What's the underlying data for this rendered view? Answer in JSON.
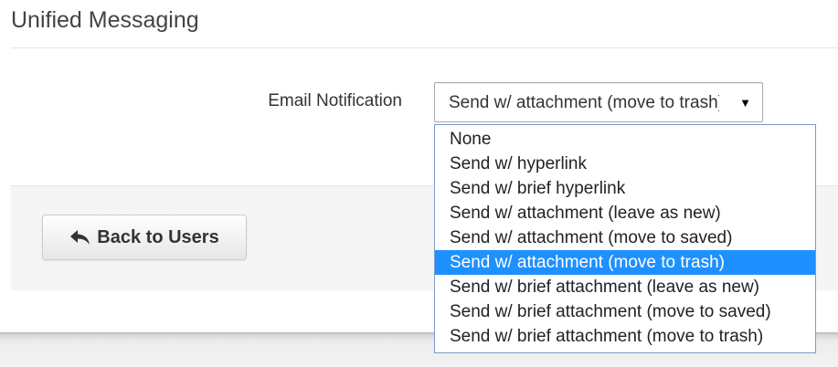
{
  "page": {
    "title": "Unified Messaging"
  },
  "email_notification": {
    "label": "Email Notification",
    "selected_value": "Send w/ attachment (move to trash)",
    "arrow": "▼",
    "selected_index": 5,
    "options": [
      "None",
      "Send w/ hyperlink",
      "Send w/ brief hyperlink",
      "Send w/ attachment (leave as new)",
      "Send w/ attachment (move to saved)",
      "Send w/ attachment (move to trash)",
      "Send w/ brief attachment (leave as new)",
      "Send w/ brief attachment (move to saved)",
      "Send w/ brief attachment (move to trash)"
    ]
  },
  "footer": {
    "back_button_label": "Back to Users",
    "back_icon": "reply-arrow-icon"
  },
  "colors": {
    "highlight": "#1e90ff",
    "dropdown_border": "#7a9cc8",
    "footer_background": "#f5f5f5"
  }
}
